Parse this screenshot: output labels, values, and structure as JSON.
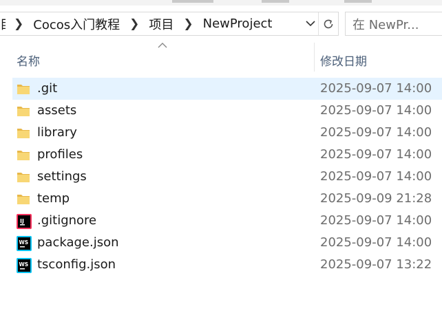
{
  "address": {
    "crumbs": [
      "Cocos入门教程",
      "项目",
      "NewProject"
    ],
    "crumb_edge": "目"
  },
  "search": {
    "placeholder": "在 NewPr..."
  },
  "columns": {
    "name": "名称",
    "date": "修改日期"
  },
  "files": [
    {
      "name": ".git",
      "date": "2025-09-07 14:00",
      "icon": "folder-icon",
      "selected": true
    },
    {
      "name": "assets",
      "date": "2025-09-07 14:00",
      "icon": "folder-icon"
    },
    {
      "name": "library",
      "date": "2025-09-07 14:00",
      "icon": "folder-icon"
    },
    {
      "name": "profiles",
      "date": "2025-09-07 14:00",
      "icon": "folder-icon"
    },
    {
      "name": "settings",
      "date": "2025-09-07 14:00",
      "icon": "folder-icon"
    },
    {
      "name": "temp",
      "date": "2025-09-09 21:28",
      "icon": "folder-icon"
    },
    {
      "name": ".gitignore",
      "date": "2025-09-07 14:00",
      "icon": "intellij-file-icon"
    },
    {
      "name": "package.json",
      "date": "2025-09-07 14:00",
      "icon": "webstorm-file-icon"
    },
    {
      "name": "tsconfig.json",
      "date": "2025-09-07 13:22",
      "icon": "webstorm-file-icon"
    }
  ],
  "colors": {
    "selection": "#e5f3ff",
    "folder": "#f8d775",
    "header_text": "#4c607a",
    "date_text": "#6d6d6d"
  }
}
